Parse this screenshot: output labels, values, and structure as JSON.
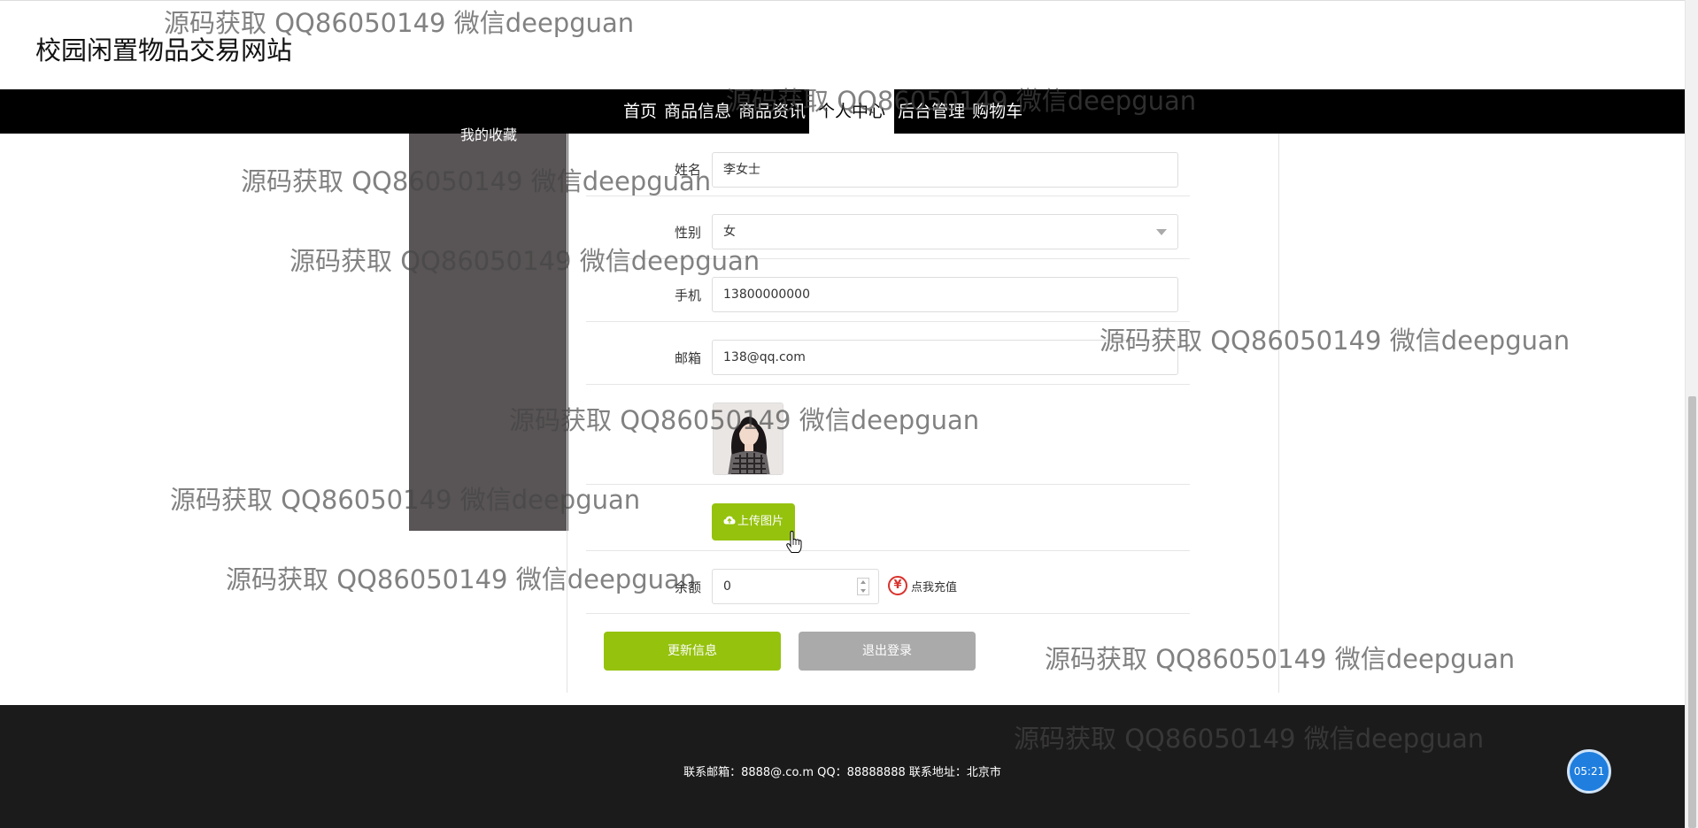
{
  "site": {
    "title": "校园闲置物品交易网站"
  },
  "nav": {
    "items": [
      {
        "label": "首页"
      },
      {
        "label": "商品信息"
      },
      {
        "label": "商品资讯"
      },
      {
        "label": "个人中心",
        "active": true
      },
      {
        "label": "后台管理"
      },
      {
        "label": "购物车"
      }
    ]
  },
  "sidebar": {
    "items": [
      {
        "label": "我的收藏"
      }
    ]
  },
  "form": {
    "name": {
      "label": "姓名",
      "value": "李女士"
    },
    "gender": {
      "label": "性别",
      "value": "女"
    },
    "phone": {
      "label": "手机",
      "value": "13800000000"
    },
    "email": {
      "label": "邮箱",
      "value": "138@qq.com"
    },
    "upload_label": "上传图片",
    "balance": {
      "label": "余额",
      "value": "0"
    },
    "recharge_label": "点我充值",
    "update_label": "更新信息",
    "logout_label": "退出登录"
  },
  "footer": {
    "text": "联系邮箱：8888@.co.m QQ：88888888 联系地址：北京市"
  },
  "timer": {
    "text": "05:21"
  },
  "watermark": {
    "text": "源码获取 QQ86050149 微信deepguan"
  },
  "colors": {
    "accent": "#95c20d",
    "nav_bg": "#000000",
    "sidebar_bg": "#595455",
    "footer_bg": "#1c1b1b",
    "logout_bg": "#aaaaaa",
    "timer_bg": "#1f7ede"
  },
  "icons": {
    "upload": "cloud-upload-icon",
    "recharge": "yen-icon",
    "select": "chevron-down-icon"
  }
}
